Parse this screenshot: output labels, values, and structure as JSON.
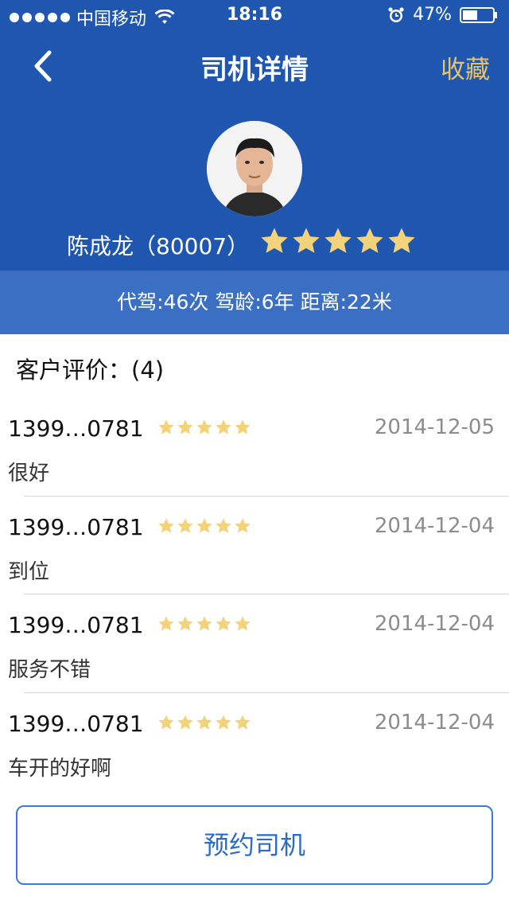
{
  "status_bar": {
    "carrier": "中国移动",
    "time": "18:16",
    "battery": "47%"
  },
  "nav": {
    "title": "司机详情",
    "favorite_label": "收藏",
    "back_icon": "chevron-left-icon"
  },
  "driver": {
    "name_id": "陈成龙（80007）",
    "rating": 5,
    "stats": "代驾:46次  驾龄:6年  距离:22米"
  },
  "reviews": {
    "header": "客户评价：(4)",
    "items": [
      {
        "phone": "1399…0781",
        "rating": 5,
        "date": "2014-12-05",
        "comment": "很好"
      },
      {
        "phone": "1399…0781",
        "rating": 5,
        "date": "2014-12-04",
        "comment": "到位"
      },
      {
        "phone": "1399…0781",
        "rating": 5,
        "date": "2014-12-04",
        "comment": "服务不错"
      },
      {
        "phone": "1399…0781",
        "rating": 5,
        "date": "2014-12-04",
        "comment": "车开的好啊"
      }
    ]
  },
  "book_button_label": "预约司机",
  "colors": {
    "header_blue": "#1f56b0",
    "stats_blue": "#3a6fc4",
    "star_gold": "#f3d27a",
    "accent": "#2d6cc4"
  }
}
